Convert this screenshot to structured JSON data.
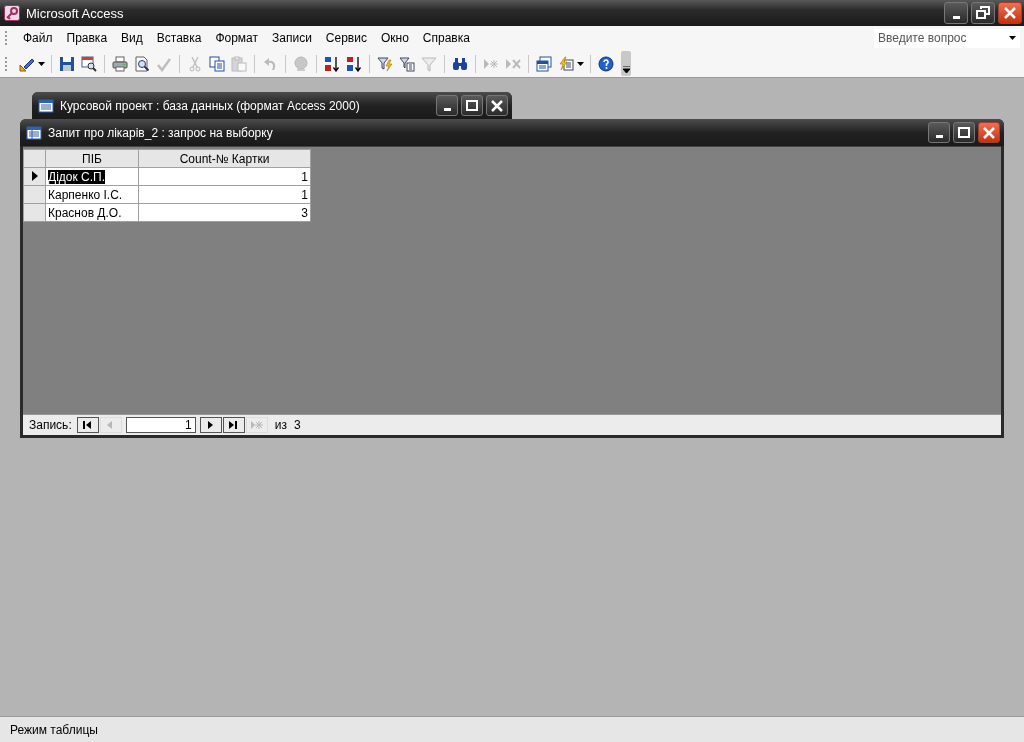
{
  "app_window": {
    "title": "Microsoft Access",
    "controls": [
      {
        "kind": "minimize"
      },
      {
        "kind": "restore"
      },
      {
        "kind": "close"
      }
    ]
  },
  "menu_bar": {
    "items": [
      "Файл",
      "Правка",
      "Вид",
      "Вставка",
      "Формат",
      "Записи",
      "Сервис",
      "Окно",
      "Справка"
    ],
    "help_search": {
      "placeholder": "Введите вопрос"
    }
  },
  "toolbar": {
    "groups": [
      [
        {
          "kind": "design-view",
          "disabled": false,
          "dropdown": true
        }
      ],
      [
        {
          "kind": "save",
          "disabled": false
        },
        {
          "kind": "file-search",
          "disabled": false
        }
      ],
      [
        {
          "kind": "print",
          "disabled": false
        },
        {
          "kind": "print-preview",
          "disabled": false
        },
        {
          "kind": "spelling",
          "disabled": true
        }
      ],
      [
        {
          "kind": "cut",
          "disabled": true
        },
        {
          "kind": "copy",
          "disabled": false
        },
        {
          "kind": "paste",
          "disabled": true
        }
      ],
      [
        {
          "kind": "undo",
          "disabled": true
        }
      ],
      [
        {
          "kind": "hyperlink",
          "disabled": true
        }
      ],
      [
        {
          "kind": "sort-ascending",
          "disabled": false
        },
        {
          "kind": "sort-descending",
          "disabled": false
        }
      ],
      [
        {
          "kind": "filter-selection",
          "disabled": false
        },
        {
          "kind": "filter-form",
          "disabled": false
        },
        {
          "kind": "apply-filter",
          "disabled": true
        }
      ],
      [
        {
          "kind": "find",
          "disabled": false
        }
      ],
      [
        {
          "kind": "new-record",
          "disabled": true
        },
        {
          "kind": "delete-record",
          "disabled": true
        }
      ],
      [
        {
          "kind": "database-window",
          "disabled": false
        },
        {
          "kind": "new-object",
          "disabled": false,
          "dropdown": true
        }
      ],
      [
        {
          "kind": "help",
          "disabled": false
        }
      ]
    ]
  },
  "database_window": {
    "title": "Курсовой проект : база данных (формат Access 2000)",
    "active": false,
    "controls": [
      {
        "kind": "minimize"
      },
      {
        "kind": "maximize"
      },
      {
        "kind": "close"
      }
    ]
  },
  "query_window": {
    "title": "Запит про лікарів_2 : запрос на выборку",
    "active": true,
    "controls": [
      {
        "kind": "minimize"
      },
      {
        "kind": "maximize"
      },
      {
        "kind": "close"
      }
    ],
    "datasheet": {
      "columns": [
        "ПІБ",
        "Count-№ Картки"
      ],
      "rows": [
        {
          "selected": true,
          "cells": [
            "Дідок С.П.",
            "1"
          ]
        },
        {
          "selected": false,
          "cells": [
            "Карпенко І.С.",
            "1"
          ]
        },
        {
          "selected": false,
          "cells": [
            "Краснов Д.О.",
            "3"
          ]
        }
      ]
    },
    "navigation": {
      "label": "Запись:",
      "buttons_before": [
        {
          "kind": "first",
          "disabled": false
        },
        {
          "kind": "previous",
          "disabled": true
        }
      ],
      "current": "1",
      "buttons_after": [
        {
          "kind": "next",
          "disabled": false
        },
        {
          "kind": "last",
          "disabled": false
        },
        {
          "kind": "new",
          "disabled": true
        }
      ],
      "of_label": "из",
      "total": "3"
    }
  },
  "status_bar": {
    "text": "Режим таблицы"
  }
}
